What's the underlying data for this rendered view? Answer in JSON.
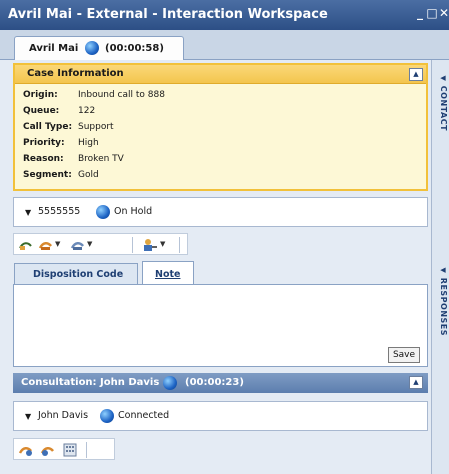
{
  "window": {
    "title": "Avril Mai - External - Interaction Workspace",
    "minimize_icon": "minimize-icon",
    "maximize_icon": "maximize-icon",
    "close_icon": "close-icon"
  },
  "call_tab": {
    "name": "Avril Mai",
    "timer": "(00:00:58)",
    "icon": "globe-icon"
  },
  "case_info": {
    "header": "Case Information",
    "fields": [
      {
        "label": "Origin:",
        "value": "Inbound call to 888"
      },
      {
        "label": "Queue:",
        "value": "122"
      },
      {
        "label": "Call Type:",
        "value": "Support"
      },
      {
        "label": "Priority:",
        "value": "High"
      },
      {
        "label": "Reason:",
        "value": "Broken TV"
      },
      {
        "label": "Segment:",
        "value": "Gold"
      }
    ]
  },
  "caller": {
    "number": "5555555",
    "status": "On Hold"
  },
  "tabs": {
    "disposition": "Disposition Code",
    "note": "Note"
  },
  "note": {
    "value": "",
    "save_label": "Save"
  },
  "consultation": {
    "header": "Consultation: John Davis",
    "timer": "(00:00:23)",
    "party_name": "John Davis",
    "party_status": "Connected"
  },
  "side_tabs": {
    "contact": "CONTACT",
    "responses": "RESPONSES"
  },
  "colors": {
    "title_bar": "#2d4f86",
    "case_header": "#f3c54e",
    "case_background": "#fdf8d6",
    "consult_header": "#5c7eae",
    "workspace_bg": "#e4ebf4"
  }
}
